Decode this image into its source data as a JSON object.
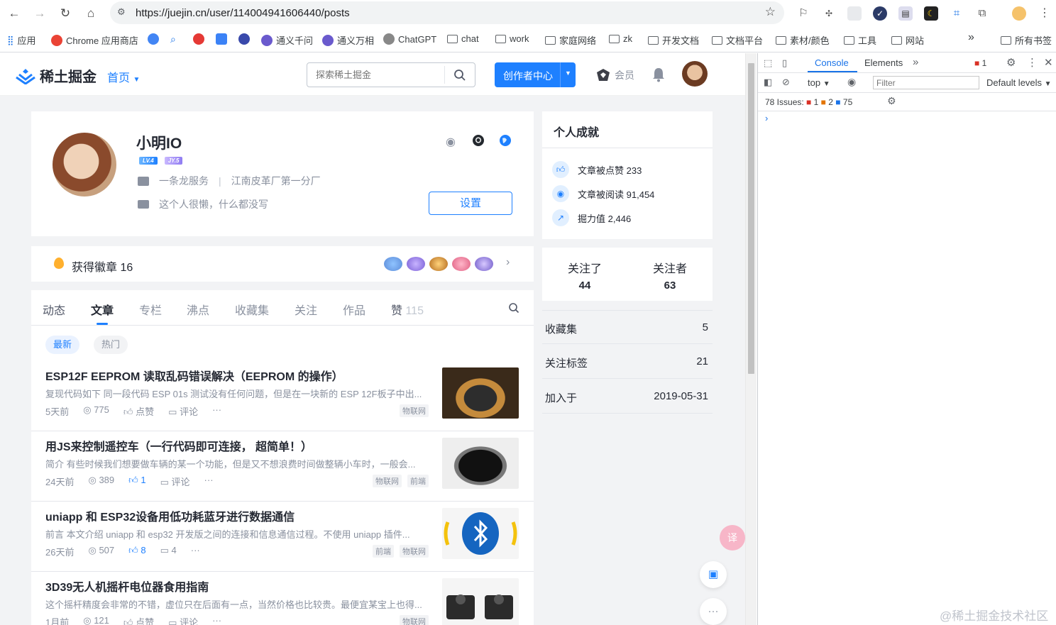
{
  "browser": {
    "url": "https://juejin.cn/user/114004941606440/posts",
    "bookmarks": [
      "应用",
      "Chrome 应用商店",
      "通义千问",
      "通义万相",
      "ChatGPT",
      "chat",
      "work",
      "家庭网络",
      "zk",
      "开发文档",
      "文档平台",
      "素材/颜色",
      "工具",
      "网站",
      "所有书签"
    ],
    "overflow_label": "»"
  },
  "site": {
    "logo_text": "稀土掘金",
    "nav_home": "首页",
    "search_placeholder": "探索稀土掘金",
    "creator_btn": "创作者中心",
    "member": "会员"
  },
  "profile": {
    "name": "小明IO",
    "badge_lv": "LV.4",
    "badge_jy": "JY.5",
    "job": "一条龙服务",
    "company": "江南皮革厂第一分厂",
    "bio": "这个人很懒，什么都没写",
    "settings_btn": "设置",
    "badges_label": "获得徽章",
    "badges_count": "16"
  },
  "tabs": [
    {
      "label": "动态"
    },
    {
      "label": "文章"
    },
    {
      "label": "专栏"
    },
    {
      "label": "沸点"
    },
    {
      "label": "收藏集"
    },
    {
      "label": "关注"
    },
    {
      "label": "作品"
    },
    {
      "label": "赞",
      "count": "115"
    }
  ],
  "sort": {
    "latest": "最新",
    "hot": "热门"
  },
  "articles": [
    {
      "title": "ESP12F EEPROM 读取乱码错误解决（EEPROM 的操作）",
      "abstract": "复现代码如下 同一段代码 ESP 01s 测试没有任何问题，但是在一块新的 ESP 12F板子中出...",
      "time": "5天前",
      "views": "775",
      "likes": "点赞",
      "comments": "评论",
      "tags": [
        "物联网"
      ]
    },
    {
      "title": "用JS来控制遥控车（一行代码即可连接， 超简单！）",
      "abstract": "简介 有些时候我们想要做车辆的某一个功能，但是又不想浪费时间做整辆小车时，一般会...",
      "time": "24天前",
      "views": "389",
      "likes": "1",
      "comments": "评论",
      "tags": [
        "物联网",
        "前端"
      ]
    },
    {
      "title": "uniapp 和 ESP32设备用低功耗蓝牙进行数据通信",
      "abstract": "前言 本文介绍 uniapp 和 esp32 开发版之间的连接和信息通信过程。不使用 uniapp 插件...",
      "time": "26天前",
      "views": "507",
      "likes": "8",
      "comments": "4",
      "tags": [
        "前端",
        "物联网"
      ]
    },
    {
      "title": "3D39无人机摇杆电位器食用指南",
      "abstract": "这个摇杆精度会非常的不错，虚位只在后面有一点，当然价格也比较贵。最便宜某宝上也得...",
      "time": "1月前",
      "views": "121",
      "likes": "点赞",
      "comments": "评论",
      "tags": [
        "物联网"
      ]
    }
  ],
  "achievements": {
    "title": "个人成就",
    "items": [
      {
        "label": "文章被点赞",
        "value": "233"
      },
      {
        "label": "文章被阅读",
        "value": "91,454"
      },
      {
        "label": "掘力值",
        "value": "2,446"
      }
    ]
  },
  "follow": {
    "following_label": "关注了",
    "following": "44",
    "followers_label": "关注者",
    "followers": "63"
  },
  "info": [
    {
      "label": "收藏集",
      "value": "5"
    },
    {
      "label": "关注标签",
      "value": "21"
    },
    {
      "label": "加入于",
      "value": "2019-05-31"
    }
  ],
  "devtools": {
    "tab_console": "Console",
    "tab_elements": "Elements",
    "error_count": "1",
    "context": "top",
    "filter_placeholder": "Filter",
    "levels": "Default levels",
    "issues_label": "78 Issues:",
    "issues_err": "1",
    "issues_warn": "2",
    "issues_info": "75"
  },
  "watermark": "@稀土掘金技术社区"
}
